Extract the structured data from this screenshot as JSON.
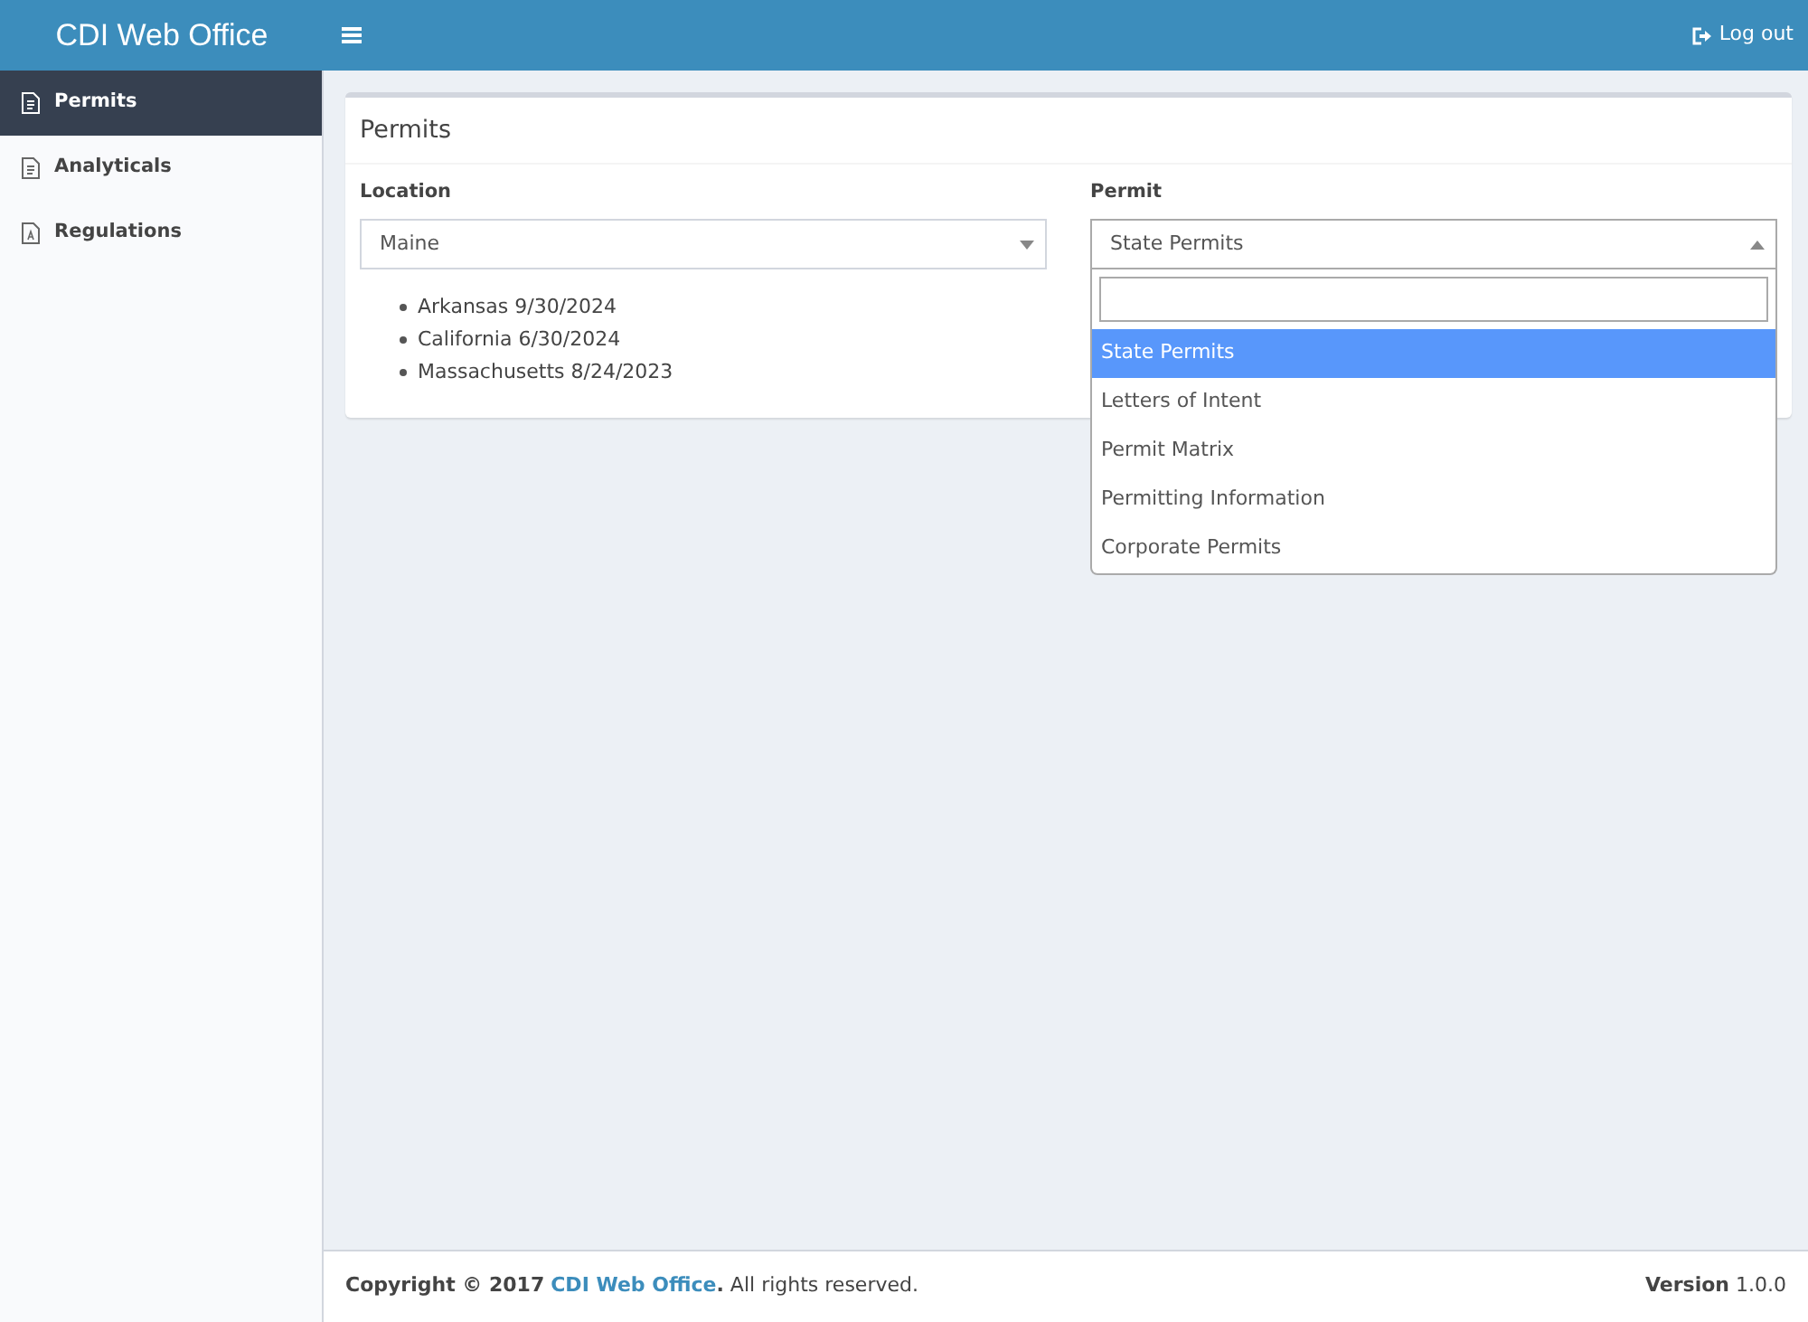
{
  "header": {
    "logo": "CDI Web Office",
    "logout": "Log out"
  },
  "sidebar": {
    "items": [
      {
        "label": "Permits",
        "kind": "document",
        "selected": true
      },
      {
        "label": "Analyticals",
        "kind": "document",
        "selected": false
      },
      {
        "label": "Regulations",
        "kind": "pdf",
        "selected": false
      }
    ]
  },
  "panel": {
    "title": "Permits",
    "location": {
      "label": "Location",
      "value": "Maine",
      "items": [
        "Arkansas 9/30/2024",
        "California 6/30/2024",
        "Massachusetts 8/24/2023"
      ]
    },
    "permit": {
      "label": "Permit",
      "value": "State Permits",
      "expanded": true,
      "options": [
        {
          "label": "State Permits",
          "selected": true
        },
        {
          "label": "Letters of Intent",
          "selected": false
        },
        {
          "label": "Permit Matrix",
          "selected": false
        },
        {
          "label": "Permitting Information",
          "selected": false
        },
        {
          "label": "Corporate Permits",
          "selected": false
        }
      ]
    }
  },
  "footer": {
    "prefix": "**Copyright © 2017** ",
    "link": "CDI Web Office",
    "suffix": "**.** All rights reserved.",
    "version": "**Version** 1.0.0"
  }
}
